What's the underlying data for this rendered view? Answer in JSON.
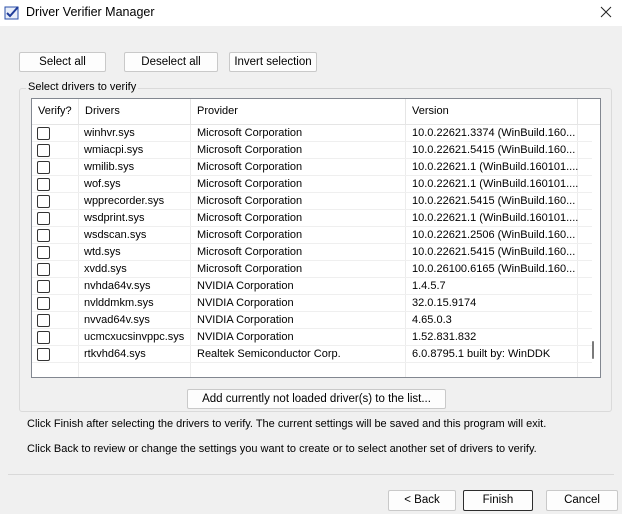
{
  "window": {
    "title": "Driver Verifier Manager"
  },
  "toolbar": {
    "select_all": "Select all",
    "deselect_all": "Deselect all",
    "invert_selection": "Invert selection"
  },
  "group": {
    "label": "Select drivers to verify"
  },
  "table": {
    "headers": [
      "Verify?",
      "Drivers",
      "Provider",
      "Version"
    ],
    "rows": [
      {
        "driver": "winhvr.sys",
        "provider": "Microsoft Corporation",
        "version": "10.0.22621.3374 (WinBuild.160..."
      },
      {
        "driver": "wmiacpi.sys",
        "provider": "Microsoft Corporation",
        "version": "10.0.22621.5415 (WinBuild.160..."
      },
      {
        "driver": "wmilib.sys",
        "provider": "Microsoft Corporation",
        "version": "10.0.22621.1 (WinBuild.160101...."
      },
      {
        "driver": "wof.sys",
        "provider": "Microsoft Corporation",
        "version": "10.0.22621.1 (WinBuild.160101...."
      },
      {
        "driver": "wpprecorder.sys",
        "provider": "Microsoft Corporation",
        "version": "10.0.22621.5415 (WinBuild.160..."
      },
      {
        "driver": "wsdprint.sys",
        "provider": "Microsoft Corporation",
        "version": "10.0.22621.1 (WinBuild.160101...."
      },
      {
        "driver": "wsdscan.sys",
        "provider": "Microsoft Corporation",
        "version": "10.0.22621.2506 (WinBuild.160..."
      },
      {
        "driver": "wtd.sys",
        "provider": "Microsoft Corporation",
        "version": "10.0.22621.5415 (WinBuild.160..."
      },
      {
        "driver": "xvdd.sys",
        "provider": "Microsoft Corporation",
        "version": "10.0.26100.6165 (WinBuild.160..."
      },
      {
        "driver": "nvhda64v.sys",
        "provider": "NVIDIA Corporation",
        "version": "1.4.5.7"
      },
      {
        "driver": "nvlddmkm.sys",
        "provider": "NVIDIA Corporation",
        "version": "32.0.15.9174"
      },
      {
        "driver": "nvvad64v.sys",
        "provider": "NVIDIA Corporation",
        "version": "4.65.0.3"
      },
      {
        "driver": "ucmcxucsinvppc.sys",
        "provider": "NVIDIA Corporation",
        "version": "1.52.831.832"
      },
      {
        "driver": "rtkvhd64.sys",
        "provider": "Realtek Semiconductor Corp.",
        "version": "6.0.8795.1 built by: WinDDK"
      }
    ]
  },
  "add_button": "Add currently not loaded driver(s) to the list...",
  "info": {
    "line1": "Click Finish after selecting the drivers to verify. The current settings will be saved and this program will exit.",
    "line2": "Click Back to review or change the settings you want to create or to select another set of drivers to verify."
  },
  "footer": {
    "back": "< Back",
    "finish": "Finish",
    "cancel": "Cancel"
  },
  "icons": {
    "app": "checklist-icon",
    "close": "close-icon",
    "checkbox": "checkbox-icon"
  }
}
